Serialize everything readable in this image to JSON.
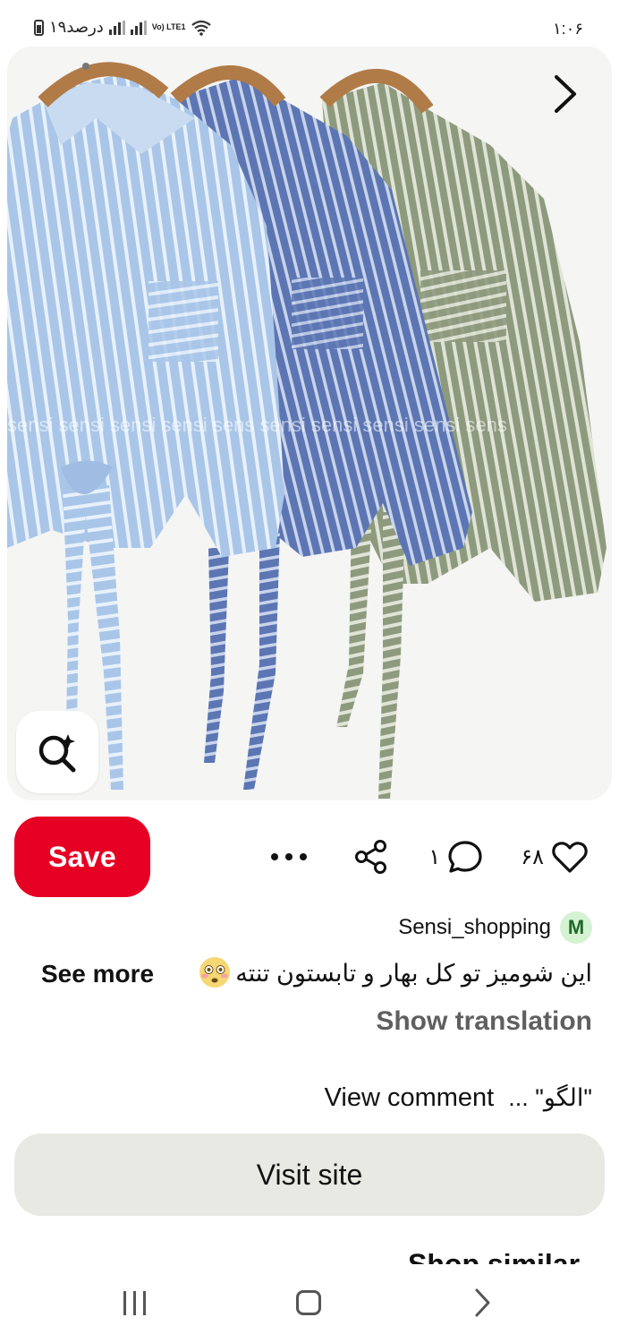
{
  "status_bar": {
    "time": "۱:۰۶",
    "battery_text": "۱۹درصد",
    "network": "Vo) LTE1"
  },
  "pin": {
    "watermark": "sensi sensi sensi sensi sens sensi sensi sensi sensi sens",
    "image_icons": [
      "chevron-right-icon",
      "visual-search-icon"
    ]
  },
  "actions": {
    "save_label": "Save",
    "likes_count": "۶۸",
    "comments_count": "۱",
    "icons": [
      "heart-icon",
      "comment-icon",
      "share-icon",
      "more-icon"
    ]
  },
  "author": {
    "avatar_letter": "M",
    "name": "Sensi_shopping",
    "avatar_color": "#d5f2d3"
  },
  "description": {
    "text": "این شومیز تو کل بهار و تابستون تنته",
    "emoji": "😳",
    "see_more": "See more",
    "show_translation": "Show translation"
  },
  "comment": {
    "preview": "\"الگو\" ...",
    "view_label": "View comment"
  },
  "visit_site_label": "Visit site",
  "next_section_heading": "Shop similar",
  "colors": {
    "save_red": "#e60023",
    "visit_bg": "#e9e9e4",
    "secondary_text": "#5f5f5f"
  }
}
